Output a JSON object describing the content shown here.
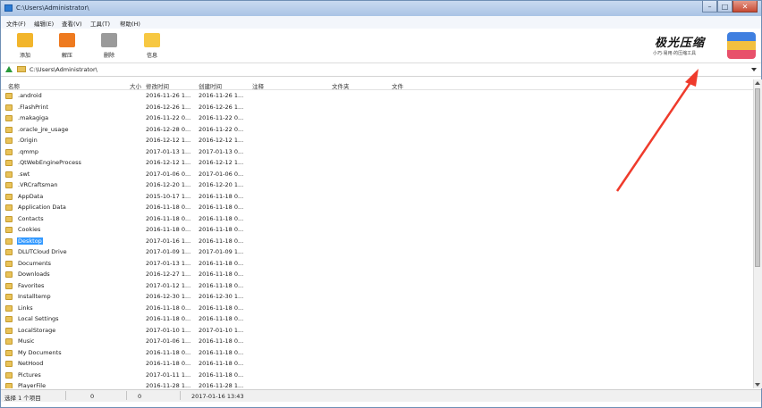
{
  "window": {
    "title": "C:\\Users\\Administrator\\",
    "min_label": "–",
    "max_label": "□",
    "close_label": "✕"
  },
  "menu": [
    "文件(F)",
    "编辑(E)",
    "查看(V)",
    "工具(T)",
    "帮助(H)"
  ],
  "toolbar": [
    {
      "label": "添加",
      "icon": "add-folder-icon",
      "color": "#f2b52b"
    },
    {
      "label": "解压",
      "icon": "extract-icon",
      "color": "#ee7a1f"
    },
    {
      "label": "删除",
      "icon": "trash-icon",
      "color": "#9a9a9a"
    },
    {
      "label": "信息",
      "icon": "info-icon",
      "color": "#f7c842"
    }
  ],
  "logo": {
    "name": "极光压缩",
    "tagline": "小巧·易用·的压缩工具",
    "colors": [
      "#3f7fe0",
      "#f2c040",
      "#e8506a"
    ]
  },
  "address": {
    "value": "C:\\Users\\Administrator\\"
  },
  "columns": {
    "name": "名称",
    "size": "大小",
    "modified": "修改时间",
    "created": "创建时间",
    "comment": "注释",
    "folders": "文件夹",
    "files": "文件"
  },
  "files": [
    {
      "name": ".android",
      "modified": "2016-11-26 1...",
      "created": "2016-11-26 1..."
    },
    {
      "name": ".FlashPrint",
      "modified": "2016-12-26 1...",
      "created": "2016-12-26 1..."
    },
    {
      "name": ".makagiga",
      "modified": "2016-11-22 0...",
      "created": "2016-11-22 0..."
    },
    {
      "name": ".oracle_jre_usage",
      "modified": "2016-12-28 0...",
      "created": "2016-11-22 0..."
    },
    {
      "name": ".Origin",
      "modified": "2016-12-12 1...",
      "created": "2016-12-12 1..."
    },
    {
      "name": ".qmmp",
      "modified": "2017-01-13 1...",
      "created": "2017-01-13 0..."
    },
    {
      "name": ".QtWebEngineProcess",
      "modified": "2016-12-12 1...",
      "created": "2016-12-12 1..."
    },
    {
      "name": ".swt",
      "modified": "2017-01-06 0...",
      "created": "2017-01-06 0..."
    },
    {
      "name": ".VRCraftsman",
      "modified": "2016-12-20 1...",
      "created": "2016-12-20 1..."
    },
    {
      "name": "AppData",
      "modified": "2015-10-17 1...",
      "created": "2016-11-18 0..."
    },
    {
      "name": "Application Data",
      "modified": "2016-11-18 0...",
      "created": "2016-11-18 0..."
    },
    {
      "name": "Contacts",
      "modified": "2016-11-18 0...",
      "created": "2016-11-18 0..."
    },
    {
      "name": "Cookies",
      "modified": "2016-11-18 0...",
      "created": "2016-11-18 0..."
    },
    {
      "name": "Desktop",
      "modified": "2017-01-16 1...",
      "created": "2016-11-18 0...",
      "selected": true
    },
    {
      "name": "DLUTCloud Drive",
      "modified": "2017-01-09 1...",
      "created": "2017-01-09 1..."
    },
    {
      "name": "Documents",
      "modified": "2017-01-13 1...",
      "created": "2016-11-18 0..."
    },
    {
      "name": "Downloads",
      "modified": "2016-12-27 1...",
      "created": "2016-11-18 0..."
    },
    {
      "name": "Favorites",
      "modified": "2017-01-12 1...",
      "created": "2016-11-18 0..."
    },
    {
      "name": "Installtemp",
      "modified": "2016-12-30 1...",
      "created": "2016-12-30 1..."
    },
    {
      "name": "Links",
      "modified": "2016-11-18 0...",
      "created": "2016-11-18 0..."
    },
    {
      "name": "Local Settings",
      "modified": "2016-11-18 0...",
      "created": "2016-11-18 0..."
    },
    {
      "name": "LocalStorage",
      "modified": "2017-01-10 1...",
      "created": "2017-01-10 1..."
    },
    {
      "name": "Music",
      "modified": "2017-01-06 1...",
      "created": "2016-11-18 0..."
    },
    {
      "name": "My Documents",
      "modified": "2016-11-18 0...",
      "created": "2016-11-18 0..."
    },
    {
      "name": "NetHood",
      "modified": "2016-11-18 0...",
      "created": "2016-11-18 0..."
    },
    {
      "name": "Pictures",
      "modified": "2017-01-11 1...",
      "created": "2016-11-18 0..."
    },
    {
      "name": "PlayerFile",
      "modified": "2016-11-28 1...",
      "created": "2016-11-28 1..."
    }
  ],
  "status": {
    "selection": "选择 1 个项目",
    "size_a": "0",
    "size_b": "0",
    "date": "2017-01-16 13:43"
  },
  "annotation": {
    "arrow_color": "#ef3b2c"
  }
}
